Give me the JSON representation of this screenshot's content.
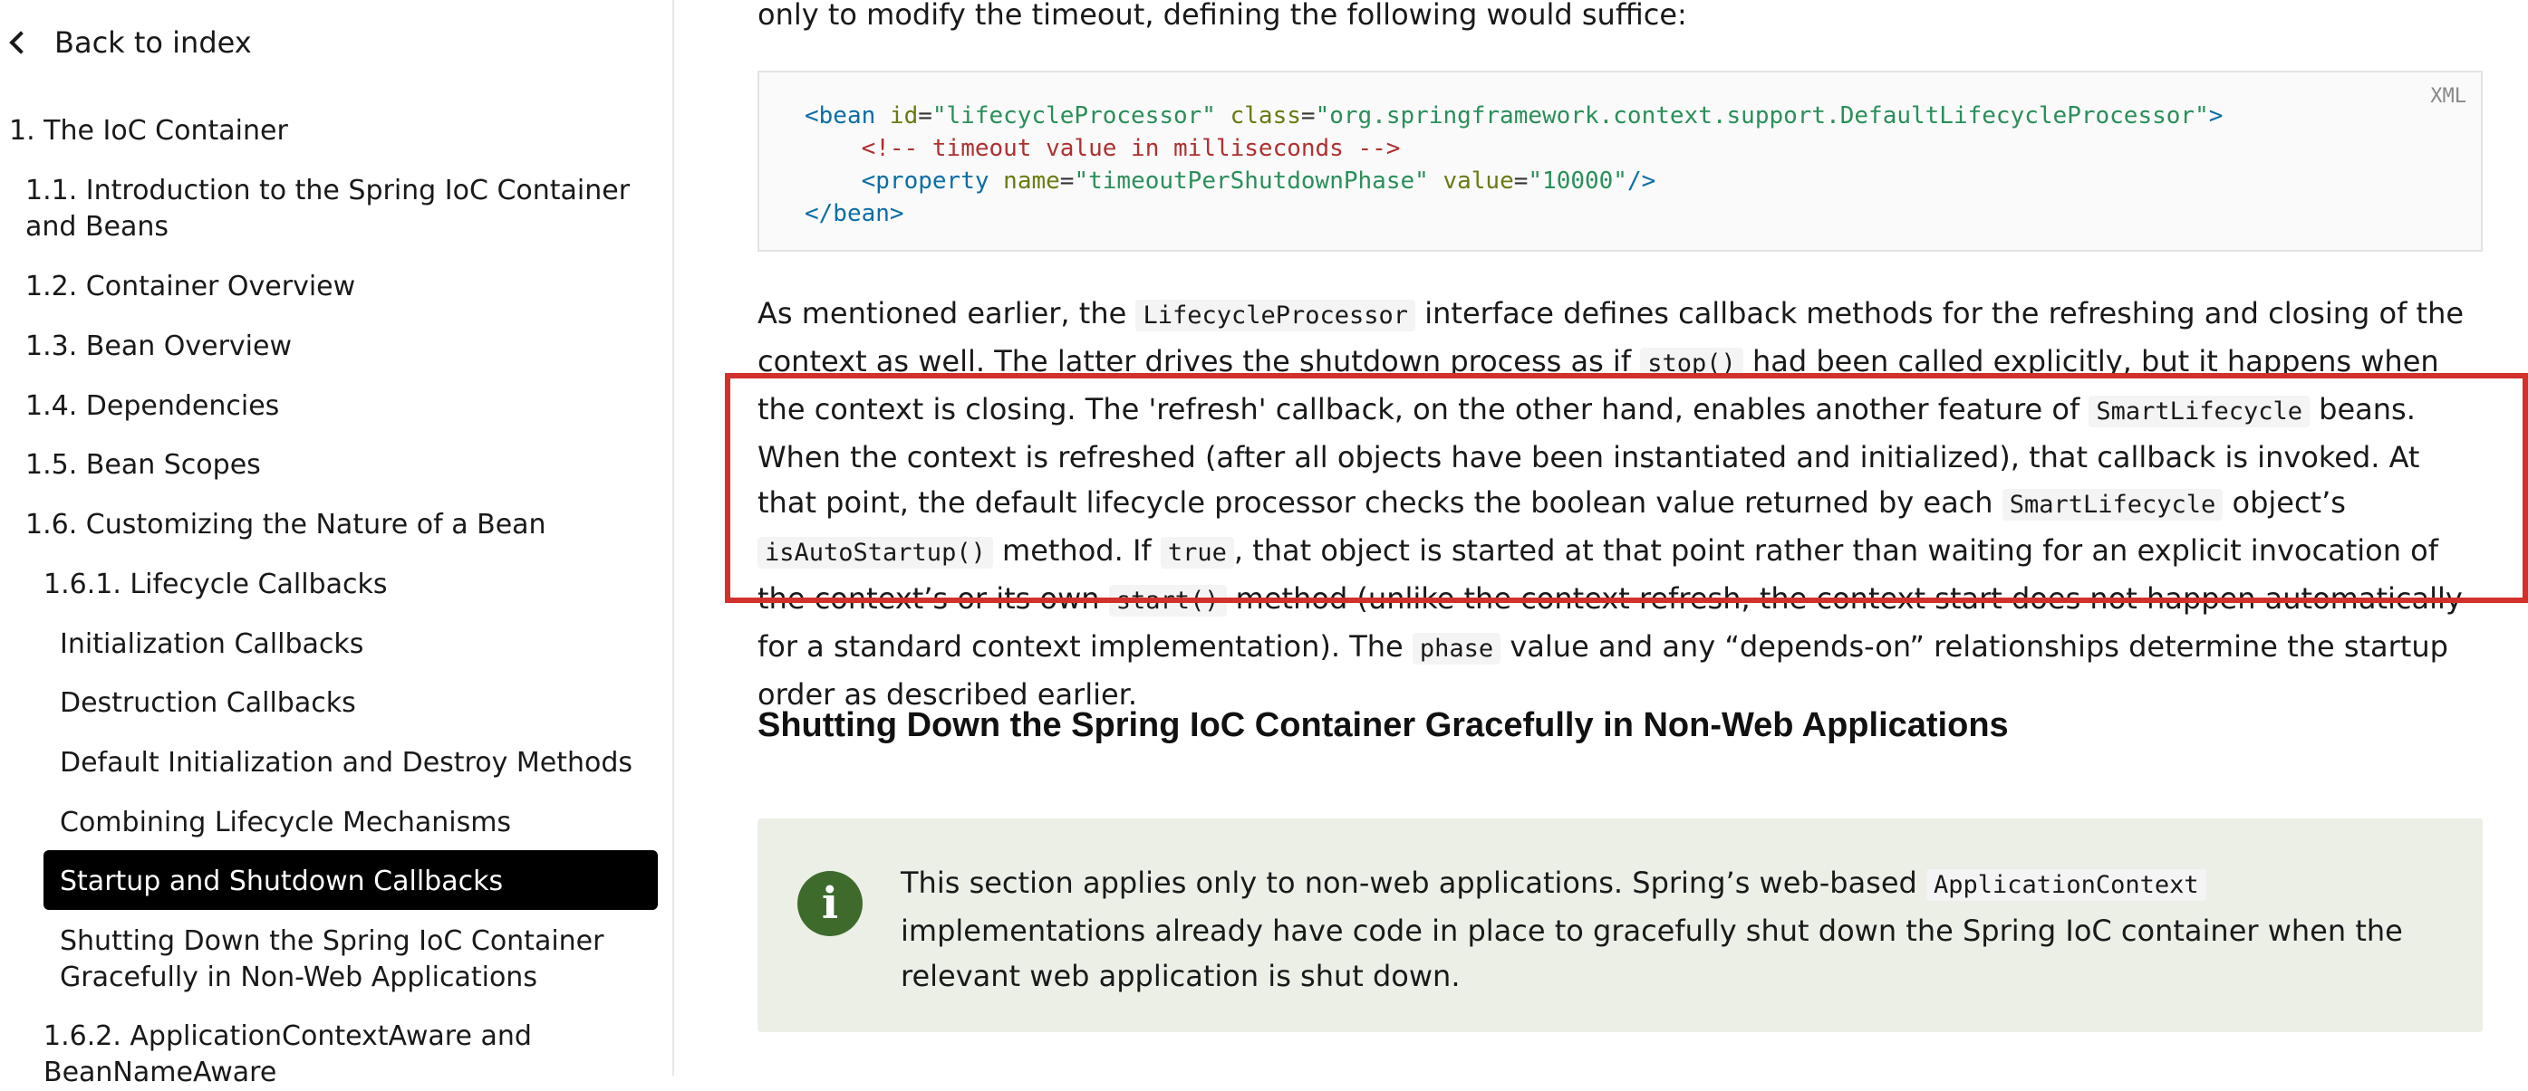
{
  "sidebar": {
    "back_label": "Back to index",
    "items": [
      {
        "label": "1. The IoC Container"
      },
      {
        "label": "1.1. Introduction to the Spring IoC Container"
      },
      {
        "label": "and Beans"
      },
      {
        "label": "1.2. Container Overview"
      },
      {
        "label": "1.3. Bean Overview"
      },
      {
        "label": "1.4. Dependencies"
      },
      {
        "label": "1.5. Bean Scopes"
      },
      {
        "label": "1.6. Customizing the Nature of a Bean"
      },
      {
        "label": "1.6.1. Lifecycle Callbacks"
      },
      {
        "label": "Initialization Callbacks"
      },
      {
        "label": "Destruction Callbacks"
      },
      {
        "label": "Default Initialization and Destroy Methods"
      },
      {
        "label": "Combining Lifecycle Mechanisms"
      },
      {
        "label": "Startup and Shutdown Callbacks"
      },
      {
        "label": "Shutting Down the Spring IoC Container"
      },
      {
        "label": "Gracefully in Non-Web Applications"
      },
      {
        "label": "1.6.2. ApplicationContextAware and"
      },
      {
        "label": "BeanNameAware"
      }
    ]
  },
  "content": {
    "intro": "only to modify the timeout, defining the following would suffice:",
    "code_lang": "XML",
    "code": {
      "l1_open": "<bean ",
      "l1_id_attr": "id",
      "l1_id_val": "\"lifecycleProcessor\"",
      "l1_class_attr": "class",
      "l1_class_val": "\"org.springframework.context.support.DefaultLifecycleProcessor\"",
      "l1_close": ">",
      "l2": "<!-- timeout value in milliseconds -->",
      "l3_open": "<property ",
      "l3_name_attr": "name",
      "l3_name_val": "\"timeoutPerShutdownPhase\"",
      "l3_value_attr": "value",
      "l3_value_val": "\"10000\"",
      "l3_close": "/>",
      "l4": "</bean>"
    },
    "para": {
      "p1": "As mentioned earlier, the ",
      "c1": "LifecycleProcessor",
      "p2": " interface defines callback methods for the refreshing and closing of the context as well. The latter drives the shutdown process as if ",
      "c2": "stop()",
      "p3": " had been called explicitly, but it happens when the context is closing. The 'refresh' callback, on the other hand, enables another feature of ",
      "c3": "SmartLifecycle",
      "p4": " beans. When the context is refreshed (after all objects have been instantiated and initialized), that callback is invoked. At that point, the default lifecycle processor checks the boolean value returned by each ",
      "c4": "SmartLifecycle",
      "p5": " object’s ",
      "c5": "isAutoStartup()",
      "p6": " method. If ",
      "c6": "true",
      "p7": ", that object is started at that point rather than waiting for an explicit invocation of the context’s or its own ",
      "c7": "start()",
      "p8": " method (unlike the context refresh, the context start does not happen automatically for a standard context implementation). The ",
      "c8": "phase",
      "p9": " value and any “depends-on” relationships determine the startup order as described earlier."
    },
    "heading": "Shutting Down the Spring IoC Container Gracefully in Non-Web Applications",
    "note": {
      "icon_glyph": "i",
      "n1": "This section applies only to non-web applications. Spring’s web-based ",
      "nc": "ApplicationContext",
      "n2": " implementations already have code in place to gracefully shut down the Spring IoC container when the relevant web application is shut down."
    }
  }
}
